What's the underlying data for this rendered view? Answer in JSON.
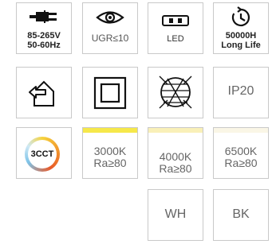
{
  "row1": {
    "voltage": {
      "line1": "85-265V",
      "line2": "50-60Hz",
      "icon": "plug-icon"
    },
    "ugr": {
      "label": "UGR≤10",
      "icon": "eye-icon"
    },
    "led": {
      "label": "LED",
      "icon": "led-chip-icon"
    },
    "life": {
      "line1": "50000H",
      "line2": "Long Life",
      "icon": "clock-arrow-icon"
    }
  },
  "row2": {
    "indoor": {
      "icon": "indoor-house-icon"
    },
    "class2": {
      "icon": "double-square-icon"
    },
    "luminaire": {
      "icon": "hatched-circle-icon"
    },
    "ip": {
      "label": "IP20"
    }
  },
  "row3": {
    "cct": {
      "label": "3CCT"
    },
    "k3000": {
      "line1": "3000K",
      "line2": "Ra≥80",
      "color": "#f6e84a"
    },
    "k4000": {
      "line1": "4000K",
      "line2": "Ra≥80",
      "color": "#f9f0b8"
    },
    "k6500": {
      "line1": "6500K",
      "line2": "Ra≥80",
      "color": "#faf6e6"
    }
  },
  "row4": {
    "wh": {
      "label": "WH"
    },
    "bk": {
      "label": "BK"
    }
  }
}
